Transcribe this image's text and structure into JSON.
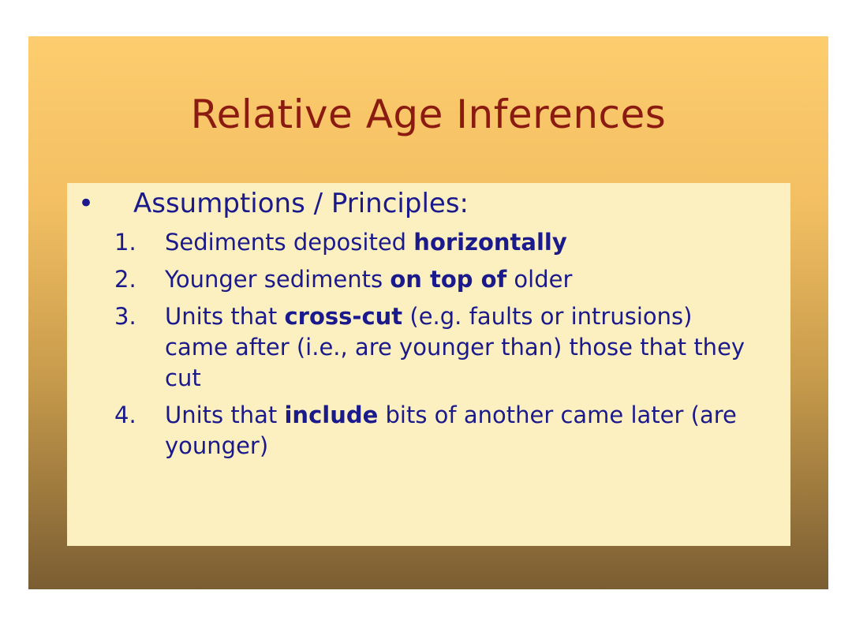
{
  "slide": {
    "title": "Relative Age Inferences",
    "bullet_symbol": "•",
    "heading": "Assumptions / Principles:",
    "items": [
      {
        "number": "1.",
        "before": "Sediments deposited ",
        "bold": "horizontally",
        "after": ""
      },
      {
        "number": "2.",
        "before": "Younger sediments ",
        "bold": "on top of",
        "after": " older"
      },
      {
        "number": "3.",
        "before": "Units that ",
        "bold": "cross-cut",
        "after": " (e.g. faults or intrusions) came after (i.e., are younger than) those that they cut"
      },
      {
        "number": "4.",
        "before": "Units that ",
        "bold": "include",
        "after": " bits of another came later (are younger)"
      }
    ]
  },
  "colors": {
    "title": "#8b1a10",
    "body_text": "#1a1a8c",
    "box_fill": "#fdf0c0",
    "gradient_top": "#fdcd6e",
    "gradient_bottom": "#7a5d32"
  }
}
